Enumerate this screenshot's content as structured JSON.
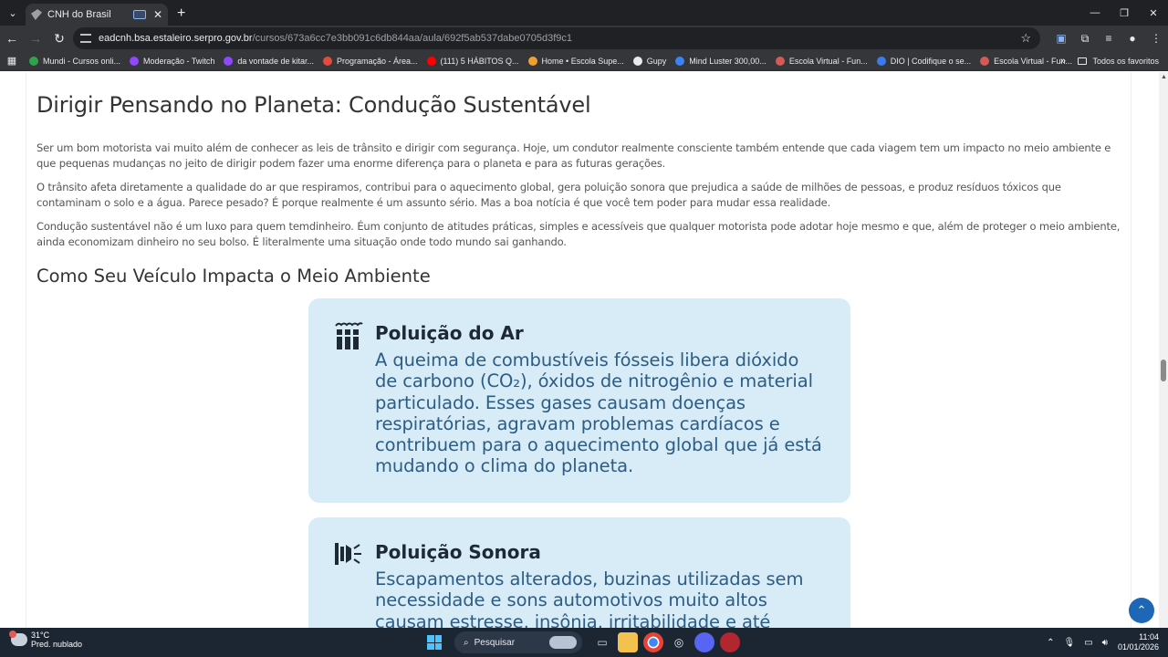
{
  "browser": {
    "tab_title": "CNH do Brasil",
    "url_host": "eadcnh.bsa.estaleiro.serpro.gov.br",
    "url_path": "/cursos/673a6cc7e3bb091c6db844aa/aula/692f5ab537dabe0705d3f9c1"
  },
  "bookmarks": {
    "items": [
      {
        "label": "Mundi - Cursos onli...",
        "color": "#31a24c"
      },
      {
        "label": "Moderação - Twitch",
        "color": "#9146ff"
      },
      {
        "label": "da vontade de kitar...",
        "color": "#9146ff"
      },
      {
        "label": "Programação - Área...",
        "color": "#e34b3f"
      },
      {
        "label": "(111) 5 HÁBITOS Q...",
        "color": "#ff0000"
      },
      {
        "label": "Home • Escola Supe...",
        "color": "#f0a030"
      },
      {
        "label": "Gupy",
        "color": "#e8eaed"
      },
      {
        "label": "Mind Luster 300,00...",
        "color": "#3b82f6"
      },
      {
        "label": "Escola Virtual - Fun...",
        "color": "#d45a5a"
      },
      {
        "label": "DIO | Codifique o se...",
        "color": "#3a7cf0"
      },
      {
        "label": "Escola Virtual - Fun...",
        "color": "#d45a5a"
      }
    ],
    "all_label": "Todos os favoritos"
  },
  "article": {
    "title": "Dirigir Pensando no Planeta: Condução Sustentável",
    "paragraphs": [
      "Ser um bom motorista vai muito além de conhecer as leis de trânsito e dirigir com segurança. Hoje, um condutor realmente consciente também entende que cada viagem tem um impacto no meio ambiente e que pequenas mudanças no jeito de dirigir podem fazer uma enorme diferença para o planeta e para as futuras gerações.",
      "O trânsito afeta diretamente a qualidade do ar que respiramos, contribui para o aquecimento global, gera poluição sonora que prejudica a saúde de milhões de pessoas, e produz resíduos tóxicos que contaminam o solo e a água. Parece pesado? É porque realmente é um assunto sério. Mas a boa notícia é que você tem poder para mudar essa realidade.",
      "Condução sustentável não é um luxo para quem temdinheiro. Éum conjunto de atitudes práticas, simples e acessíveis que qualquer motorista pode adotar hoje mesmo e que, além de proteger o meio ambiente, ainda economizam dinheiro no seu bolso. É literalmente uma situação onde todo mundo sai ganhando."
    ],
    "section_title": "Como Seu Veículo Impacta o Meio Ambiente",
    "cards": [
      {
        "icon": "smokestack-icon",
        "title": "Poluição do Ar",
        "text": "A queima de combustíveis fósseis libera dióxido de carbono (CO₂), óxidos de nitrogênio e material particulado. Esses gases causam doenças respiratórias, agravam problemas cardíacos e contribuem para o aquecimento global que já está mudando o clima do planeta."
      },
      {
        "icon": "sound-waves-icon",
        "title": "Poluição Sonora",
        "text": "Escapamentos alterados, buzinas utilizadas sem necessidade e sons automotivos muito altos causam estresse, insônia, irritabilidade e até"
      }
    ]
  },
  "taskbar": {
    "temperature": "31°C",
    "weather": "Pred. nublado",
    "search_placeholder": "Pesquisar",
    "time": "11:04",
    "date": "01/01/2026"
  },
  "colors": {
    "card_bg": "#d7ecf7",
    "card_text": "#2d5c84",
    "accent": "#1e66b6"
  }
}
